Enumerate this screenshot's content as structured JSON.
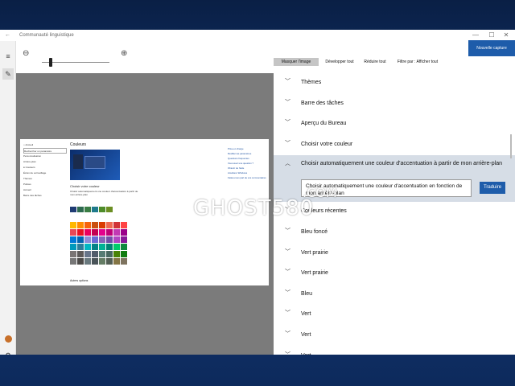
{
  "app": {
    "title": "Communauté linguistique",
    "back_glyph": "←",
    "window_controls": [
      "—",
      "☐",
      "✕"
    ]
  },
  "sidebar": {
    "menu_icon": "hamburger-icon",
    "pen_icon": "pen-icon",
    "settings_icon": "gear-icon"
  },
  "zoom": {
    "out_glyph": "⊖",
    "in_glyph": "⊕",
    "level": 0.14
  },
  "capture_button": "Nouvelle capture",
  "right_toolbar": {
    "hide_image": "Masquer l'image",
    "expand_all": "Développer tout",
    "collapse_all": "Réduire tout",
    "filter": "Filtre par : Afficher tout"
  },
  "strings": [
    {
      "label": "Thèmes",
      "expanded": false
    },
    {
      "label": "Barre des tâches",
      "expanded": false
    },
    {
      "label": "Aperçu du Bureau",
      "expanded": false
    },
    {
      "label": "Choisir votre couleur",
      "expanded": false
    },
    {
      "label": "Choisir automatiquement une couleur d'accentuation à partir de mon arrière-plan",
      "expanded": true,
      "translation": "Choisir automatiquement une couleur d'accentuation en fonction de mon arrière-plan",
      "translate_label": "Traduire"
    },
    {
      "label": "Couleurs récentes",
      "expanded": false
    },
    {
      "label": "Bleu foncé",
      "expanded": false
    },
    {
      "label": "Vert prairie",
      "expanded": false
    },
    {
      "label": "Vert prairie",
      "expanded": false
    },
    {
      "label": "Bleu",
      "expanded": false
    },
    {
      "label": "Vert",
      "expanded": false
    },
    {
      "label": "Vert",
      "expanded": false
    },
    {
      "label": "Vert",
      "expanded": false
    }
  ],
  "preview": {
    "heading": "Couleurs",
    "nav": [
      "⌂ Accueil",
      "Rechercher un paramètre",
      "Personnalisation",
      "Arrière-plan",
      "● Couleurs",
      "Écran de verrouillage",
      "Thèmes",
      "Polices",
      "Accueil",
      "Barre des tâches"
    ],
    "choose_color": "Choisir votre couleur",
    "auto_check": "Choisir automatiquement une couleur d'accentuation à partir de mon arrière-plan",
    "recent_colors": [
      "#1f3b73",
      "#2d6a4f",
      "#3a7d44",
      "#1f7a8c",
      "#4f8c2a",
      "#6b8e23"
    ],
    "windows_colors": [
      "#ffb900",
      "#ff8c00",
      "#f7630c",
      "#ca5010",
      "#da3b01",
      "#ef6950",
      "#d13438",
      "#ff4343",
      "#e74856",
      "#e81123",
      "#ea005e",
      "#c30052",
      "#e3008c",
      "#bf0077",
      "#c239b3",
      "#9a0089",
      "#0078d7",
      "#0063b1",
      "#8e8cd8",
      "#6b69d6",
      "#8764b8",
      "#744da9",
      "#b146c2",
      "#881798",
      "#0099bc",
      "#2d7d9a",
      "#00b7c3",
      "#038387",
      "#00b294",
      "#018574",
      "#00cc6a",
      "#10893e",
      "#7a7574",
      "#5d5a58",
      "#68768a",
      "#515c6b",
      "#567c73",
      "#486860",
      "#498205",
      "#107c10",
      "#767676",
      "#4c4a48",
      "#69797e",
      "#4a5459",
      "#647c64",
      "#525e54",
      "#847545",
      "#7e735f"
    ],
    "custom_color": "Couleur personnalisée",
    "other_options": "Autres options",
    "right_links": [
      "Prise en charge",
      "Modifier les paramètres",
      "Questions fréquentes",
      "Vous avez une question ?",
      "Obtenir de l'aide",
      "Améliorer Windows",
      "Faites-nous part de vos commentaires"
    ]
  },
  "watermark": {
    "text": "GHOST580",
    "sub": ".COM"
  }
}
